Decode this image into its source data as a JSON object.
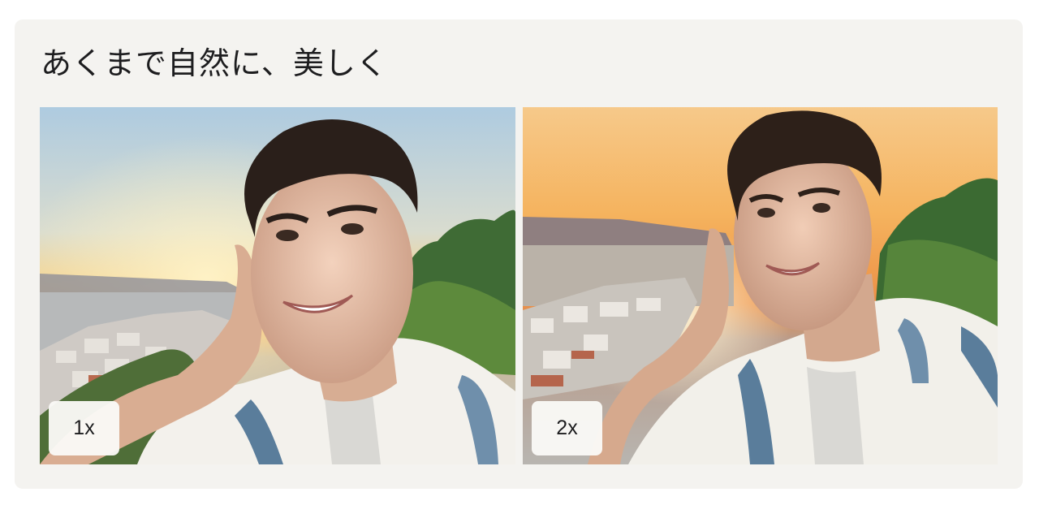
{
  "card": {
    "title": "あくまで自然に、美しく"
  },
  "photos": [
    {
      "zoom_label": "1x"
    },
    {
      "zoom_label": "2x"
    }
  ],
  "colors": {
    "card_background": "#f4f3f0",
    "title_text": "#1d1d1f",
    "badge_background": "#faf9f6"
  }
}
